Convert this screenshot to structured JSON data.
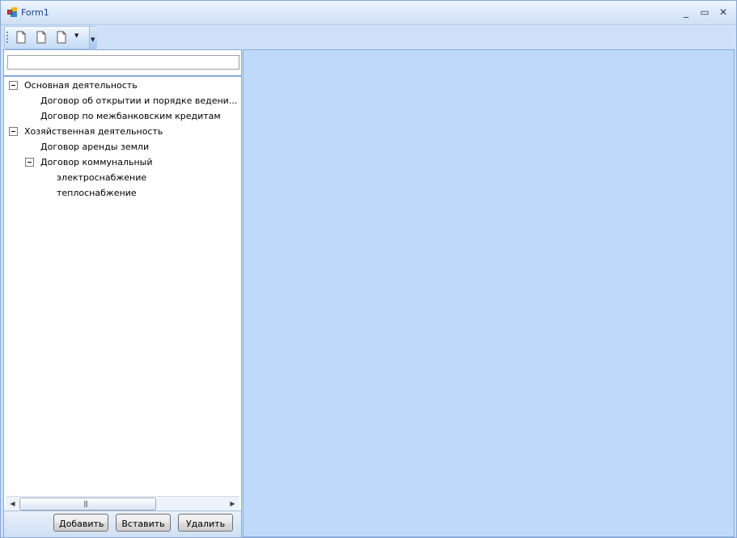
{
  "window": {
    "title": "Form1"
  },
  "titlebar": {
    "minimize_glyph": "_",
    "maximize_glyph": "▭",
    "close_glyph": "✕"
  },
  "toolbar": {
    "buttons": [
      {
        "icon": "new-document-icon"
      },
      {
        "icon": "document-icon"
      },
      {
        "icon": "document-dropdown-icon"
      }
    ],
    "dropdown_arrow": "▼",
    "overflow_glyph": "▼"
  },
  "search": {
    "value": "",
    "placeholder": ""
  },
  "tree": {
    "nodes": [
      {
        "label": "Основная деятельность",
        "level": 0,
        "expanded": true
      },
      {
        "label": "Договор об открытии и порядке ведени...",
        "level": 1
      },
      {
        "label": "Договор по межбанковским кредитам",
        "level": 1
      },
      {
        "label": "Хозяйственная деятельность",
        "level": 0,
        "expanded": true
      },
      {
        "label": "Договор аренды земли",
        "level": 1
      },
      {
        "label": "Договор коммунальный",
        "level": 1,
        "expanded": true
      },
      {
        "label": "электроснабжение",
        "level": 2
      },
      {
        "label": "теплоснабжение",
        "level": 2
      }
    ]
  },
  "scrollbar": {
    "left_arrow": "◀",
    "right_arrow": "▶",
    "thumb_grip": "|||"
  },
  "buttons": {
    "add": "Добавить",
    "insert": "Вставить",
    "delete": "Удалить"
  },
  "colors": {
    "workspace": "#bfd9fb",
    "title_text": "#15428b",
    "border": "#8aa9d6"
  }
}
